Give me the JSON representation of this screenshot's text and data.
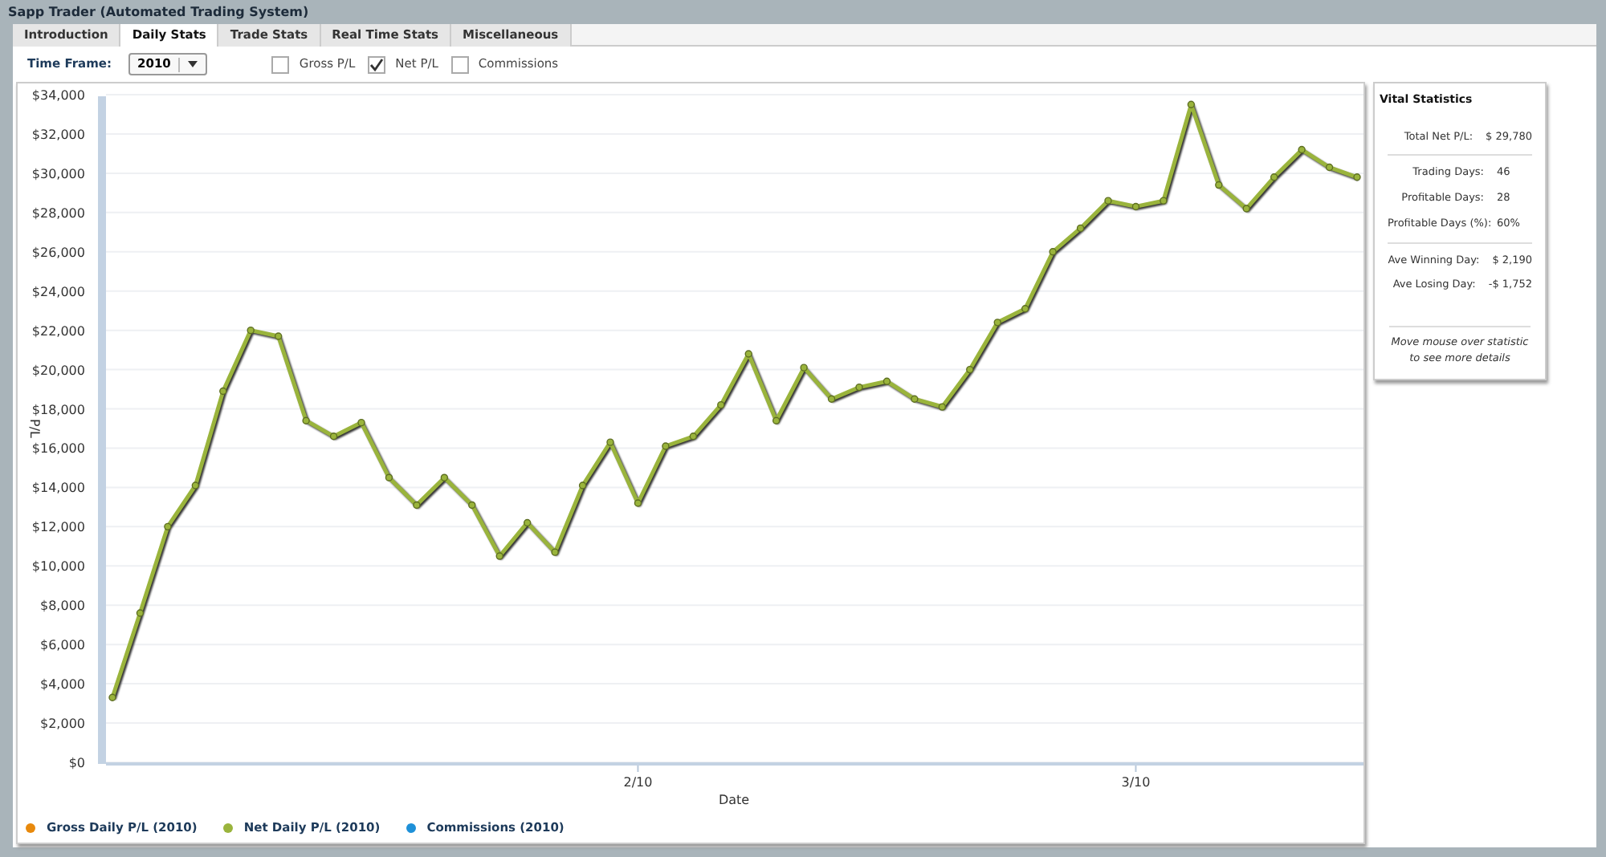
{
  "window": {
    "title": "Sapp Trader (Automated Trading System)"
  },
  "tabs": [
    {
      "label": "Introduction",
      "selected": false
    },
    {
      "label": "Daily Stats",
      "selected": true
    },
    {
      "label": "Trade Stats",
      "selected": false
    },
    {
      "label": "Real Time Stats",
      "selected": false
    },
    {
      "label": "Miscellaneous",
      "selected": false
    }
  ],
  "time_frame": {
    "label": "Time Frame:",
    "value": "2010"
  },
  "filters": [
    {
      "label": "Gross P/L",
      "checked": false
    },
    {
      "label": "Net P/L",
      "checked": true
    },
    {
      "label": "Commissions",
      "checked": false
    }
  ],
  "chart": {
    "chart_data": {
      "type": "line",
      "grid": true,
      "xlabel": "Date",
      "ylabel": "P/L",
      "ylim": [
        0,
        34000
      ],
      "yticks": [
        {
          "value": 0,
          "label": "$0"
        },
        {
          "value": 2000,
          "label": "$2,000"
        },
        {
          "value": 4000,
          "label": "$4,000"
        },
        {
          "value": 6000,
          "label": "$6,000"
        },
        {
          "value": 8000,
          "label": "$8,000"
        },
        {
          "value": 10000,
          "label": "$10,000"
        },
        {
          "value": 12000,
          "label": "$12,000"
        },
        {
          "value": 14000,
          "label": "$14,000"
        },
        {
          "value": 16000,
          "label": "$16,000"
        },
        {
          "value": 18000,
          "label": "$18,000"
        },
        {
          "value": 20000,
          "label": "$20,000"
        },
        {
          "value": 22000,
          "label": "$22,000"
        },
        {
          "value": 24000,
          "label": "$24,000"
        },
        {
          "value": 26000,
          "label": "$26,000"
        },
        {
          "value": 28000,
          "label": "$28,000"
        },
        {
          "value": 30000,
          "label": "$30,000"
        },
        {
          "value": 32000,
          "label": "$32,000"
        },
        {
          "value": 34000,
          "label": "$34,000"
        }
      ],
      "categories": [
        null,
        null,
        null,
        null,
        null,
        null,
        null,
        null,
        null,
        null,
        null,
        null,
        null,
        null,
        null,
        null,
        null,
        null,
        null,
        "2/10",
        null,
        null,
        null,
        null,
        null,
        null,
        null,
        null,
        null,
        null,
        null,
        null,
        null,
        null,
        null,
        null,
        null,
        "3/10",
        null,
        null,
        null,
        null,
        null,
        null,
        null,
        null
      ],
      "series": [
        {
          "name": "Net Daily P/L (2010)",
          "color": "#9ab43c",
          "marker": "o",
          "values": [
            3300,
            7600,
            12000,
            14100,
            18900,
            22000,
            21700,
            17400,
            16600,
            17300,
            14500,
            13100,
            14500,
            13100,
            10500,
            12200,
            10700,
            14100,
            16300,
            13200,
            16100,
            16600,
            18200,
            20800,
            17400,
            20100,
            18500,
            19100,
            19400,
            18500,
            18100,
            20000,
            22400,
            23100,
            26000,
            27200,
            28600,
            28300,
            28600,
            33500,
            29400,
            28200,
            29800,
            31200,
            30300,
            29800
          ]
        }
      ]
    },
    "legend": [
      {
        "kind": "item",
        "label": "Gross Daily P/L (2010)",
        "color": "#e8890c"
      },
      {
        "kind": "series"
      },
      {
        "kind": "item",
        "label": "Commissions (2010)",
        "color": "#1e90d8"
      }
    ]
  },
  "vital_statistics": {
    "title": "Vital Statistics",
    "groups": [
      [
        {
          "label": "Total Net P/L:",
          "value": "$ 29,780"
        }
      ],
      [
        {
          "label": "Trading Days:",
          "value": "46"
        },
        {
          "label": "Profitable Days:",
          "value": "28"
        },
        {
          "label": "Profitable Days (%):",
          "value": "60%"
        }
      ],
      [
        {
          "label": "Ave Winning Day:",
          "value": "$ 2,190"
        },
        {
          "label": "Ave Losing Day:",
          "value": "-$ 1,752"
        }
      ]
    ],
    "hint": "Move mouse over statistic to see more details"
  }
}
